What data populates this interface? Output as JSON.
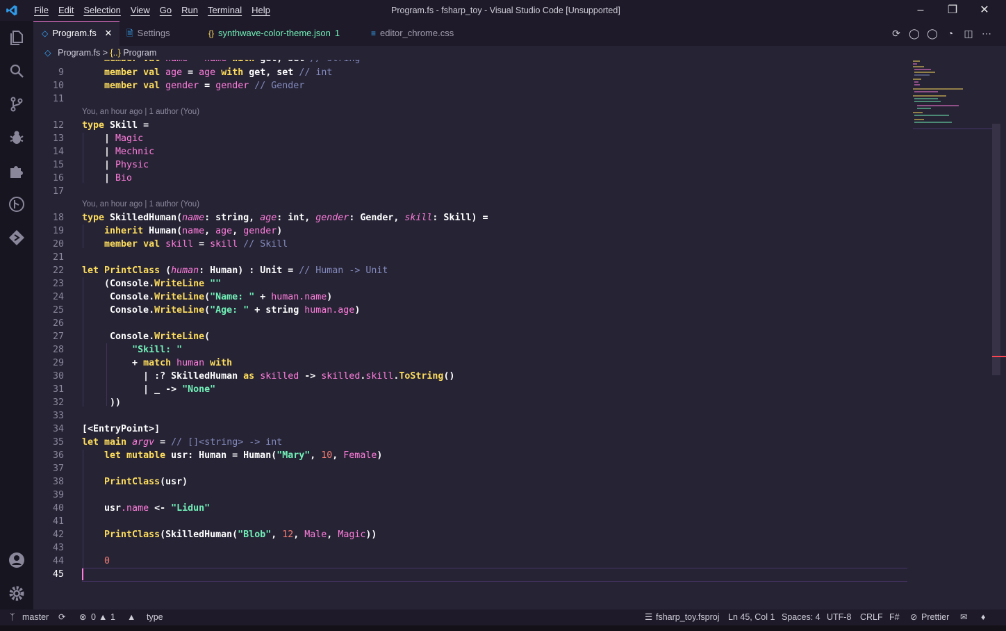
{
  "colors": {
    "background": "#262335",
    "keyword": "#fede5d",
    "string": "#ff8b39",
    "comment": "#848bbd",
    "accent": "#ff7edb"
  },
  "titlebar": {
    "menu": [
      "File",
      "Edit",
      "Selection",
      "View",
      "Go",
      "Run",
      "Terminal",
      "Help"
    ],
    "title": "Program.fs - fsharp_toy - Visual Studio Code [Unsupported]"
  },
  "tabs": [
    {
      "label": "Program.fs",
      "icon": "fsharp-file-icon",
      "active": true
    },
    {
      "label": "Settings",
      "icon": "settings-file-icon"
    },
    {
      "label": "synthwave-color-theme.json",
      "icon": "json-file-icon",
      "badge": "1"
    },
    {
      "label": "editor_chrome.css",
      "icon": "css-file-icon"
    }
  ],
  "breadcrumb": {
    "file": "Program.fs",
    "separator": ">",
    "symbol_icon": "{..}",
    "symbol": "Program"
  },
  "codelens": {
    "line12": "You, an hour ago | 1 author (You)",
    "line18": "You, an hour ago | 1 author (You)"
  },
  "line_numbers": [
    "9",
    "10",
    "11",
    "12",
    "13",
    "14",
    "15",
    "16",
    "17",
    "18",
    "19",
    "20",
    "21",
    "22",
    "23",
    "24",
    "25",
    "26",
    "27",
    "28",
    "29",
    "30",
    "31",
    "32",
    "33",
    "34",
    "35",
    "36",
    "37",
    "38",
    "39",
    "40",
    "41",
    "42",
    "43",
    "44",
    "45"
  ],
  "statusbar": {
    "branch": "master",
    "errors": "0",
    "warnings": "1",
    "mode": "type",
    "project": "fsharp_toy.fsproj",
    "position": "Ln 45, Col 1",
    "spaces": "Spaces: 4",
    "encoding": "UTF-8",
    "eol": "CRLF",
    "language": "F#",
    "formatter": "Prettier"
  }
}
